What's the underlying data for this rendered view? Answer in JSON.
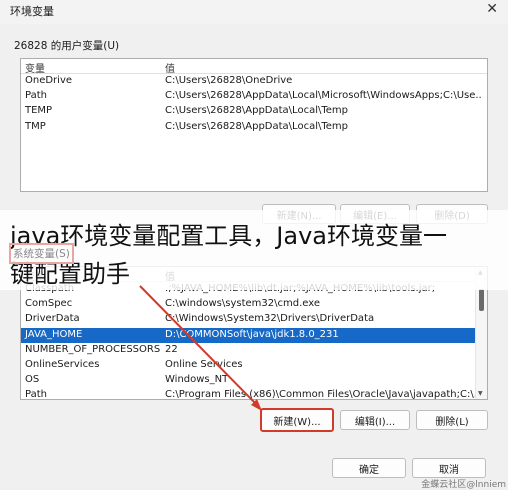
{
  "window": {
    "title": "环境变量",
    "close_symbol": "✕"
  },
  "user_section": {
    "label": "26828 的用户变量(U)",
    "columns": [
      "变量",
      "值"
    ],
    "rows": [
      {
        "name": "OneDrive",
        "value": "C:\\Users\\26828\\OneDrive"
      },
      {
        "name": "Path",
        "value": "C:\\Users\\26828\\AppData\\Local\\Microsoft\\WindowsApps;C:\\Use..."
      },
      {
        "name": "TEMP",
        "value": "C:\\Users\\26828\\AppData\\Local\\Temp"
      },
      {
        "name": "TMP",
        "value": "C:\\Users\\26828\\AppData\\Local\\Temp"
      }
    ],
    "buttons": {
      "new": "新建(N)...",
      "edit": "编辑(E)...",
      "delete": "删除(D)"
    }
  },
  "system_section": {
    "label": "系统变量(S)",
    "columns": [
      "变量",
      "值"
    ],
    "rows": [
      {
        "name": "Classpath",
        "value": ".;%JAVA_HOME%\\lib\\dt.jar;%JAVA_HOME%\\lib\\tools.jar;"
      },
      {
        "name": "ComSpec",
        "value": "C:\\windows\\system32\\cmd.exe"
      },
      {
        "name": "DriverData",
        "value": "C:\\Windows\\System32\\Drivers\\DriverData"
      },
      {
        "name": "JAVA_HOME",
        "value": "D:\\COMMONSoft\\java\\jdk1.8.0_231",
        "selected": true
      },
      {
        "name": "NUMBER_OF_PROCESSORS",
        "value": "22"
      },
      {
        "name": "OnlineServices",
        "value": "Online Services"
      },
      {
        "name": "OS",
        "value": "Windows_NT"
      },
      {
        "name": "Path",
        "value": "C:\\Program Files (x86)\\Common Files\\Oracle\\Java\\javapath;C:\\..."
      }
    ],
    "buttons": {
      "new": "新建(W)...",
      "edit": "编辑(I)...",
      "delete": "删除(L)"
    }
  },
  "footer": {
    "ok": "确定",
    "cancel": "取消"
  },
  "overlay": {
    "line1": "java环境变量配置工具，Java环境变量一",
    "line2": "键配置助手"
  },
  "watermark": "金蝶云社区@lnniem",
  "colors": {
    "selection": "#1769c7",
    "highlight_red": "#d23b2a"
  }
}
